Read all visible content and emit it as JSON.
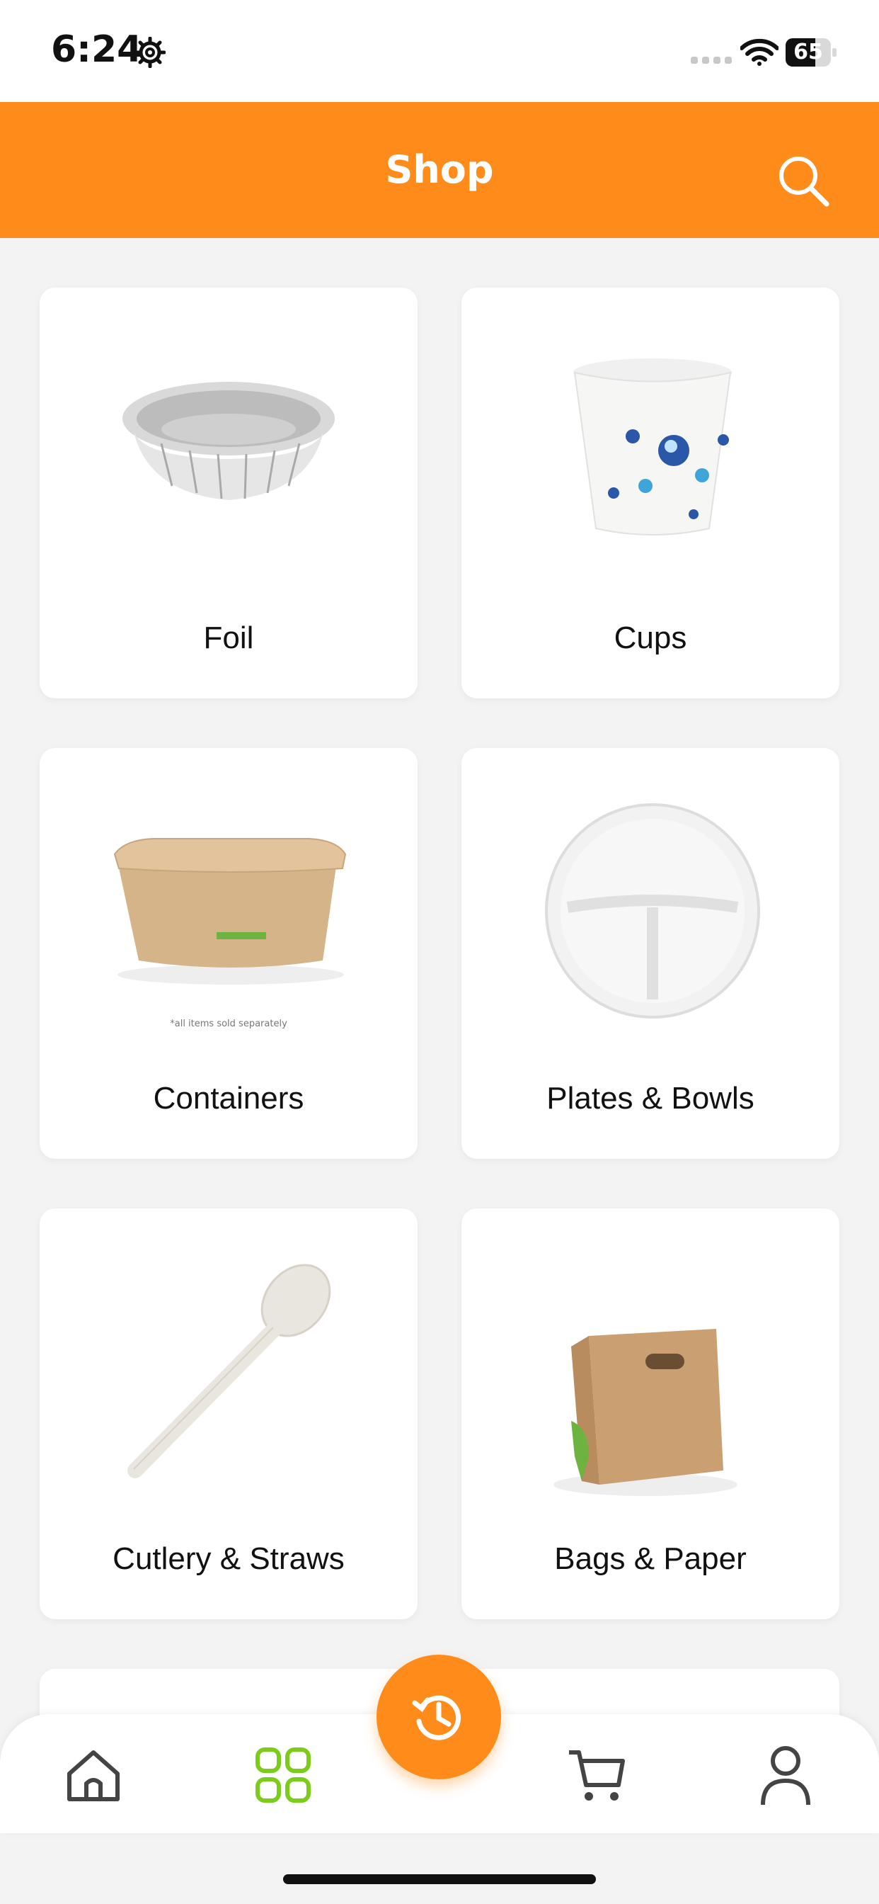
{
  "status_bar": {
    "time": "6:24",
    "battery": "65",
    "battery_level": 0.65
  },
  "header": {
    "title": "Shop"
  },
  "categories": [
    {
      "label": "Foil"
    },
    {
      "label": "Cups"
    },
    {
      "label": "Containers",
      "note": "*all items sold separately"
    },
    {
      "label": "Plates & Bowls"
    },
    {
      "label": "Cutlery & Straws"
    },
    {
      "label": "Bags & Paper"
    }
  ],
  "nav": {
    "items": [
      {
        "name": "home"
      },
      {
        "name": "categories",
        "active": true
      },
      {
        "name": "cart"
      },
      {
        "name": "profile"
      }
    ],
    "fab": "history"
  },
  "colors": {
    "accent": "#ff8c1a",
    "active_nav": "#7ccc1a",
    "background": "#f3f3f3"
  }
}
